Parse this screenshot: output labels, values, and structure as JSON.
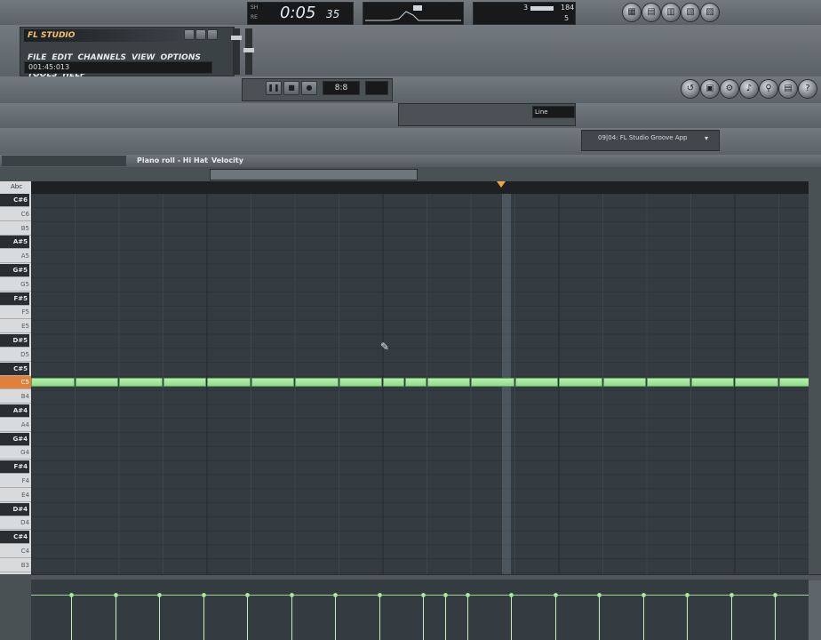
{
  "app": {
    "logo": "FL STUDIO",
    "menu": [
      "FILE",
      "EDIT",
      "CHANNELS",
      "VIEW",
      "OPTIONS",
      "TOOLS",
      "HELP"
    ],
    "hint": "001:45:013"
  },
  "transport": {
    "time_main": "0:05",
    "time_sub": "35",
    "mode_top": "SH",
    "mode_bottom": "RE",
    "tempo_display": "8:8",
    "cpu_value_1": "3",
    "cpu_value_2": "184",
    "cpu_value_3": "5"
  },
  "snap": {
    "value": "Line"
  },
  "browser": {
    "current": "09|04: FL Studio Groove App"
  },
  "piano_roll": {
    "title": "Piano roll - Hi Hat",
    "target": "Velocity",
    "keys": [
      "C#6",
      "C6",
      "B5",
      "A#5",
      "A5",
      "G#5",
      "G5",
      "F#5",
      "F5",
      "E5",
      "D#5",
      "D5",
      "C#5",
      "C5",
      "B4",
      "A#4",
      "A4",
      "G#4",
      "G4",
      "F#4",
      "F4",
      "E4",
      "D#4",
      "D4",
      "C#4",
      "C4",
      "B3"
    ],
    "keys_label": "Abc",
    "notes_key": "C5",
    "note_starts_steps": [
      0,
      1,
      2,
      3,
      4,
      5,
      6,
      7,
      8,
      8.5,
      9,
      10,
      11,
      12,
      13,
      14,
      15,
      16,
      17
    ],
    "note_lengths_steps": [
      1,
      1,
      1,
      1,
      1,
      1,
      1,
      1,
      0.5,
      0.5,
      1,
      1,
      1,
      1,
      1,
      1,
      1,
      1,
      1
    ],
    "velocity_level": 0.78,
    "playhead_step": 10.8
  },
  "colors": {
    "note": "#9fe496",
    "grid_bg": "#343c42",
    "accent": "#e0803a"
  }
}
